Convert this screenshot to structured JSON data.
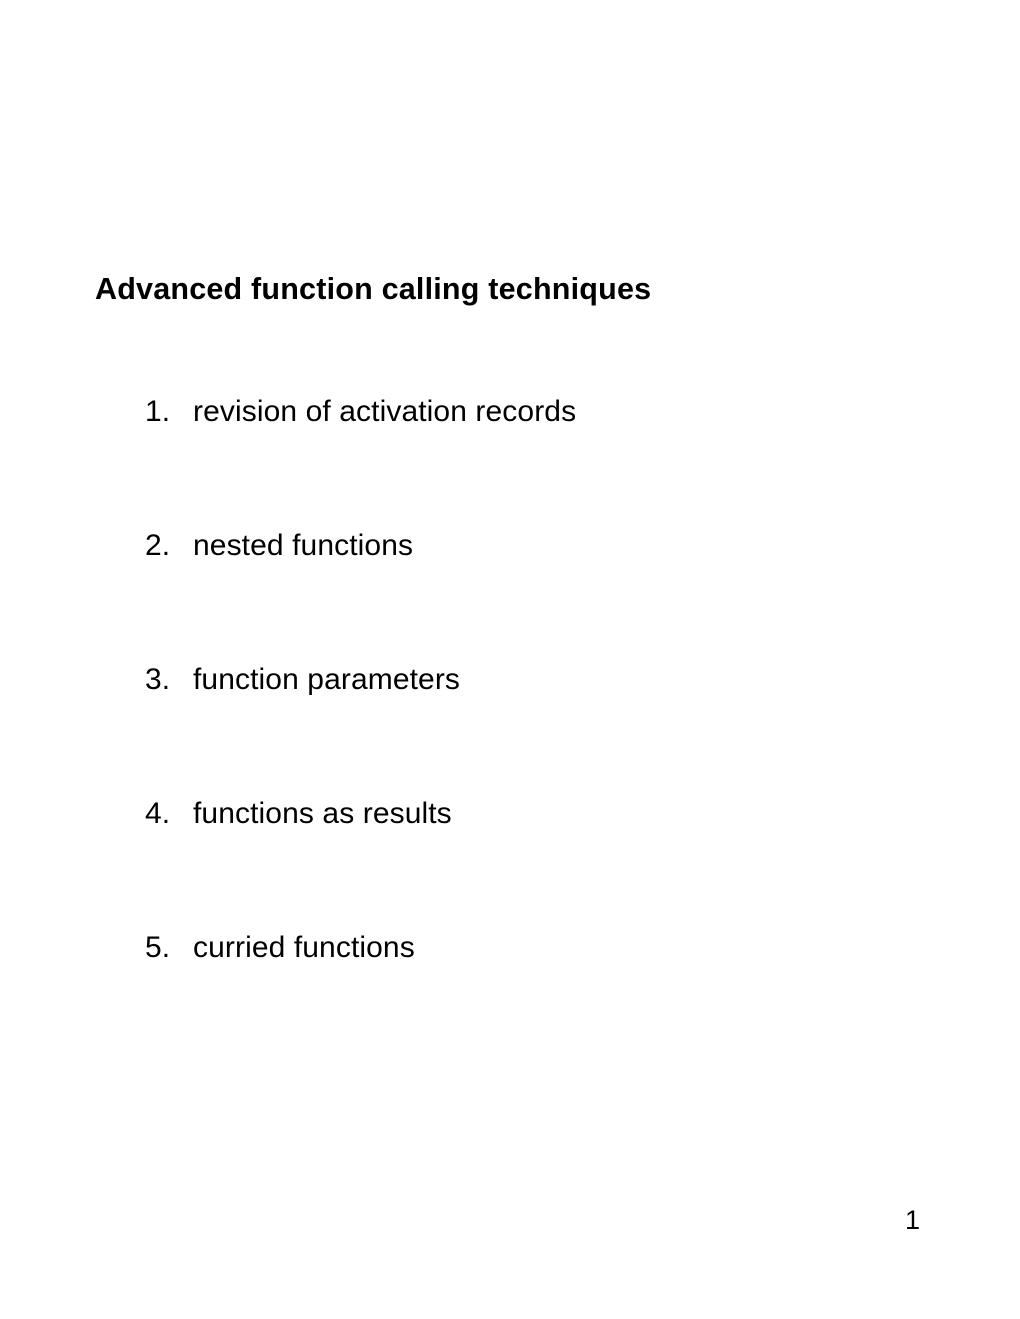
{
  "title": "Advanced function calling techniques",
  "items": [
    {
      "number": "1.",
      "text": "revision of activation records"
    },
    {
      "number": "2.",
      "text": "nested functions"
    },
    {
      "number": "3.",
      "text": "function parameters"
    },
    {
      "number": "4.",
      "text": "functions as results"
    },
    {
      "number": "5.",
      "text": "curried functions"
    }
  ],
  "pageNumber": "1"
}
